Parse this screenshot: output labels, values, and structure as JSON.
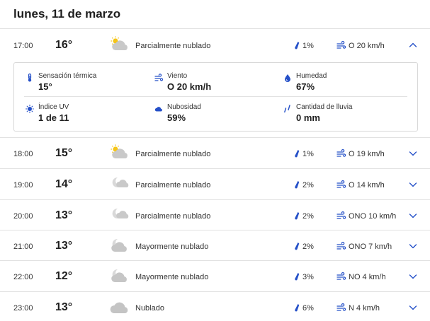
{
  "day_title": "lunes, 11 de marzo",
  "colors": {
    "accent": "#2550c8",
    "sun": "#f5c518",
    "cloud": "#c8c8c8"
  },
  "hours": [
    {
      "time": "17:00",
      "temp": "16°",
      "condition": "Parcialmente nublado",
      "icon": "partly-cloudy-day-icon",
      "precip": "1%",
      "wind": "O 20 km/h",
      "expanded": true
    },
    {
      "time": "18:00",
      "temp": "15°",
      "condition": "Parcialmente nublado",
      "icon": "partly-cloudy-day-icon",
      "precip": "1%",
      "wind": "O 19 km/h",
      "expanded": false
    },
    {
      "time": "19:00",
      "temp": "14°",
      "condition": "Parcialmente nublado",
      "icon": "partly-cloudy-night-icon",
      "precip": "2%",
      "wind": "O 14 km/h",
      "expanded": false
    },
    {
      "time": "20:00",
      "temp": "13°",
      "condition": "Parcialmente nublado",
      "icon": "partly-cloudy-night-icon",
      "precip": "2%",
      "wind": "ONO 10 km/h",
      "expanded": false
    },
    {
      "time": "21:00",
      "temp": "13°",
      "condition": "Mayormente nublado",
      "icon": "mostly-cloudy-night-icon",
      "precip": "2%",
      "wind": "ONO 7 km/h",
      "expanded": false
    },
    {
      "time": "22:00",
      "temp": "12°",
      "condition": "Mayormente nublado",
      "icon": "mostly-cloudy-night-icon",
      "precip": "3%",
      "wind": "NO 4 km/h",
      "expanded": false
    },
    {
      "time": "23:00",
      "temp": "13°",
      "condition": "Nublado",
      "icon": "cloudy-icon",
      "precip": "6%",
      "wind": "N 4 km/h",
      "expanded": false
    }
  ],
  "details": {
    "feels_like": {
      "label": "Sensación térmica",
      "value": "15°",
      "icon": "thermometer-icon"
    },
    "wind": {
      "label": "Viento",
      "value": "O 20 km/h",
      "icon": "wind-icon"
    },
    "humidity": {
      "label": "Humedad",
      "value": "67%",
      "icon": "humidity-drop-icon"
    },
    "uv": {
      "label": "Índice UV",
      "value": "1 de 11",
      "icon": "uv-sun-icon"
    },
    "cloud_cover": {
      "label": "Nubosidad",
      "value": "59%",
      "icon": "cloud-icon"
    },
    "rain_amount": {
      "label": "Cantidad de lluvia",
      "value": "0 mm",
      "icon": "rain-drops-icon"
    }
  }
}
